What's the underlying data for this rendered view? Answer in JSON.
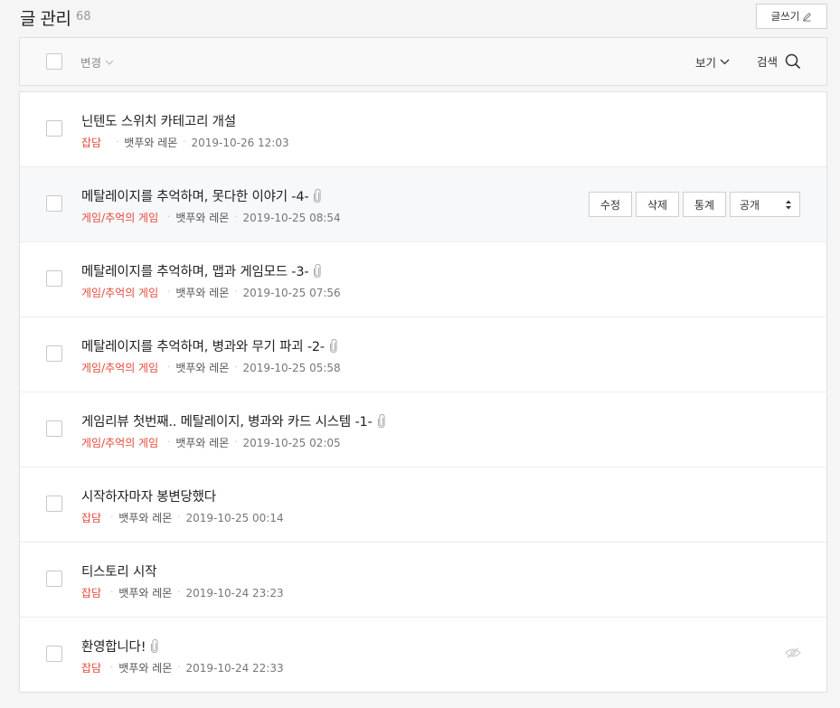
{
  "header": {
    "title": "글 관리",
    "count": "68",
    "write_label": "글쓰기"
  },
  "toolbar": {
    "change_label": "변경",
    "view_label": "보기",
    "search_label": "검색"
  },
  "row_actions": {
    "edit_label": "수정",
    "delete_label": "삭제",
    "stats_label": "통계",
    "visibility_value": "공개"
  },
  "posts": [
    {
      "title": "닌텐도 스위치 카테고리 개설",
      "category": "잡담",
      "author": "뱃푸와 레몬",
      "date": "2019-10-26 12:03",
      "attachment": false
    },
    {
      "title": "메탈레이지를 추억하며, 못다한 이야기 -4-",
      "category": "게임/추억의 게임",
      "author": "뱃푸와 레몬",
      "date": "2019-10-25 08:54",
      "attachment": true
    },
    {
      "title": "메탈레이지를 추억하며, 맵과 게임모드 -3-",
      "category": "게임/추억의 게임",
      "author": "뱃푸와 레몬",
      "date": "2019-10-25 07:56",
      "attachment": true
    },
    {
      "title": "메탈레이지를 추억하며, 병과와 무기 파괴 -2-",
      "category": "게임/추억의 게임",
      "author": "뱃푸와 레몬",
      "date": "2019-10-25 05:58",
      "attachment": true
    },
    {
      "title": "게임리뷰 첫번째.. 메탈레이지, 병과와 카드 시스템 -1-",
      "category": "게임/추억의 게임",
      "author": "뱃푸와 레몬",
      "date": "2019-10-25 02:05",
      "attachment": true
    },
    {
      "title": "시작하자마자 봉변당했다",
      "category": "잡담",
      "author": "뱃푸와 레몬",
      "date": "2019-10-25 00:14",
      "attachment": false
    },
    {
      "title": "티스토리 시작",
      "category": "잡담",
      "author": "뱃푸와 레몬",
      "date": "2019-10-24 23:23",
      "attachment": false
    },
    {
      "title": "환영합니다!",
      "category": "잡담",
      "author": "뱃푸와 레몬",
      "date": "2019-10-24 22:33",
      "attachment": true
    }
  ],
  "icons": {
    "write": "pencil-icon",
    "change": "chevron-down-icon",
    "view": "chevron-down-icon",
    "search": "search-icon",
    "attachment": "paperclip-icon",
    "visibility": "updown-icon",
    "private": "eye-slash-icon"
  },
  "colors": {
    "category": "#e34a3a",
    "hover_row": "#f7f8fa"
  }
}
